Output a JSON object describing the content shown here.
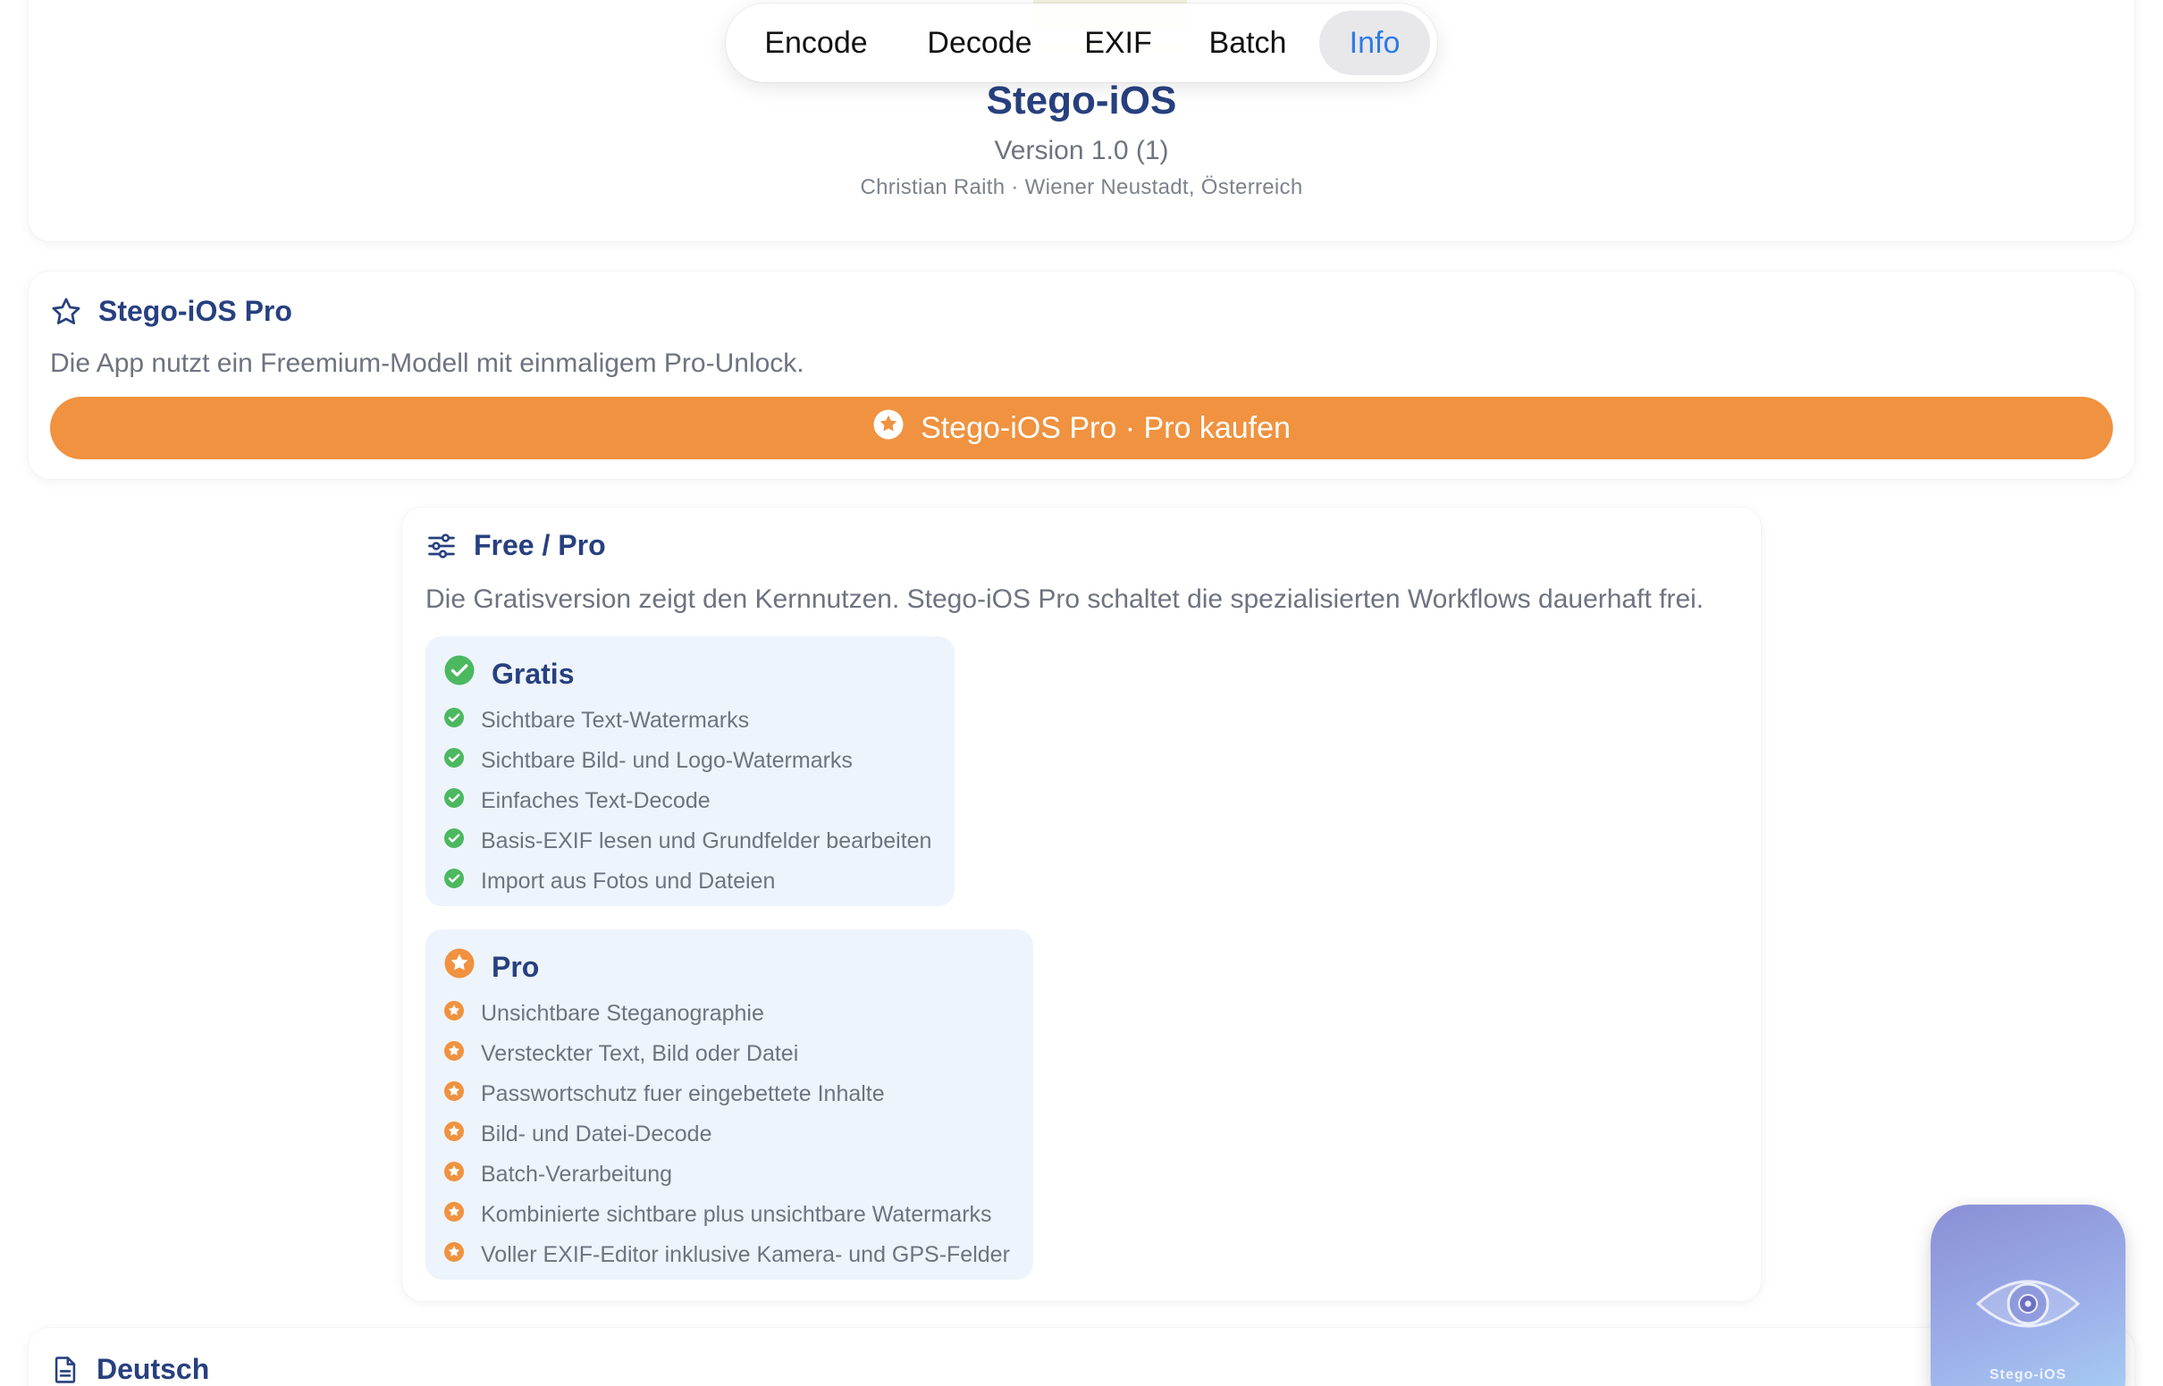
{
  "tabs": [
    {
      "label": "Encode",
      "active": false
    },
    {
      "label": "Decode",
      "active": false
    },
    {
      "label": "EXIF",
      "active": false
    },
    {
      "label": "Batch",
      "active": false
    },
    {
      "label": "Info",
      "active": true
    }
  ],
  "header": {
    "title": "Stego-iOS",
    "version": "Version 1.0 (1)",
    "author": "Christian Raith · Wiener Neustadt, Österreich"
  },
  "pro_section": {
    "icon": "star-outline-icon",
    "title": "Stego-iOS Pro",
    "description": "Die App nutzt ein Freemium-Modell mit einmaligem Pro-Unlock.",
    "button_icon": "star-circle-icon",
    "button_label": "Stego-iOS Pro · Pro kaufen"
  },
  "free_pro": {
    "icon": "sliders-icon",
    "title": "Free / Pro",
    "description": "Die Gratisversion zeigt den Kernnutzen. Stego-iOS Pro schaltet die spezialisierten Workflows dauerhaft frei.",
    "free": {
      "icon": "check-circle-icon",
      "title": "Gratis",
      "items": [
        "Sichtbare Text-Watermarks",
        "Sichtbare Bild- und Logo-Watermarks",
        "Einfaches Text-Decode",
        "Basis-EXIF lesen und Grundfelder bearbeiten",
        "Import aus Fotos und Dateien"
      ]
    },
    "pro": {
      "icon": "star-circle-icon",
      "title": "Pro",
      "items": [
        "Unsichtbare Steganographie",
        "Versteckter Text, Bild oder Datei",
        "Passwortschutz fuer eingebettete Inhalte",
        "Bild- und Datei-Decode",
        "Batch-Verarbeitung",
        "Kombinierte sichtbare plus unsichtbare Watermarks",
        "Voller EXIF-Editor inklusive Kamera- und GPS-Felder"
      ]
    }
  },
  "language_section": {
    "icon": "document-icon",
    "title": "Deutsch"
  },
  "floating_icon": {
    "icon": "eye-icon",
    "label": "Stego-iOS"
  },
  "colors": {
    "accent_blue": "#2f7ae5",
    "title_navy": "#27407f",
    "pro_orange": "#f0923f",
    "free_green": "#4cb860",
    "tier_background": "#eef4fc",
    "muted_text": "#6e7380"
  }
}
